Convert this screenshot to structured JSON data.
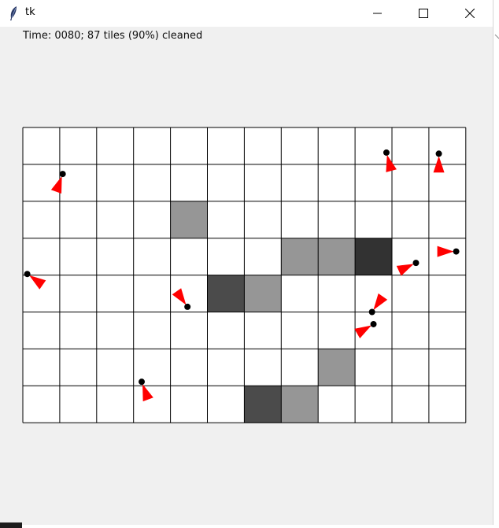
{
  "window": {
    "title": "tk",
    "app_icon": "feather-icon",
    "controls": [
      "minimize-icon",
      "maximize-icon",
      "close-icon"
    ]
  },
  "status": {
    "text": "Time: 0080; 87 tiles (90%) cleaned"
  },
  "room": {
    "columns": 12,
    "rows": 8,
    "grid_line_color": "#000000",
    "clean_color": "#ffffff",
    "dirty_tiles": [
      {
        "col": 4,
        "row": 2,
        "shade": "#969696"
      },
      {
        "col": 7,
        "row": 3,
        "shade": "#969696"
      },
      {
        "col": 8,
        "row": 3,
        "shade": "#969696"
      },
      {
        "col": 9,
        "row": 3,
        "shade": "#323232"
      },
      {
        "col": 5,
        "row": 4,
        "shade": "#4b4b4b"
      },
      {
        "col": 6,
        "row": 4,
        "shade": "#969696"
      },
      {
        "col": 8,
        "row": 6,
        "shade": "#969696"
      },
      {
        "col": 6,
        "row": 7,
        "shade": "#4b4b4b"
      },
      {
        "col": 7,
        "row": 7,
        "shade": "#969696"
      }
    ]
  },
  "robots": {
    "marker_color": "#ff0000",
    "dot_color": "#000000",
    "items": [
      {
        "x": 1.08,
        "y": 1.26,
        "heading": 200
      },
      {
        "x": 9.85,
        "y": 0.68,
        "heading": 165
      },
      {
        "x": 11.27,
        "y": 0.71,
        "heading": 180
      },
      {
        "x": 11.74,
        "y": 3.36,
        "heading": 270
      },
      {
        "x": 10.65,
        "y": 3.67,
        "heading": 245
      },
      {
        "x": 0.12,
        "y": 3.97,
        "heading": 125
      },
      {
        "x": 4.46,
        "y": 4.86,
        "heading": 325
      },
      {
        "x": 9.46,
        "y": 5.0,
        "heading": 35
      },
      {
        "x": 9.5,
        "y": 5.33,
        "heading": 240
      },
      {
        "x": 3.22,
        "y": 6.89,
        "heading": 160
      }
    ]
  }
}
